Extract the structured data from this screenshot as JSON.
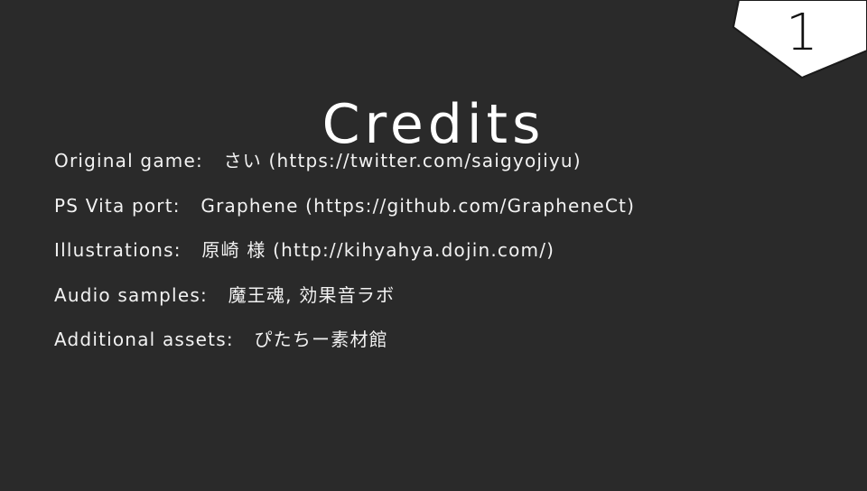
{
  "page_number": "1",
  "title": "Credits",
  "credits": [
    {
      "label": "Original game:",
      "value": "さい (https://twitter.com/saigyojiyu)"
    },
    {
      "label": "PS Vita port:",
      "value": "Graphene (https://github.com/GrapheneCt)"
    },
    {
      "label": "Illustrations:",
      "value": "原崎 様 (http://kihyahya.dojin.com/)"
    },
    {
      "label": "Audio samples:",
      "value": "魔王魂, 効果音ラボ"
    },
    {
      "label": "Additional assets:",
      "value": "ぴたちー素材館"
    }
  ],
  "colors": {
    "background": "#2a2a2a",
    "text": "#ffffff",
    "badge_fill": "#ffffff",
    "badge_text": "#111111"
  }
}
